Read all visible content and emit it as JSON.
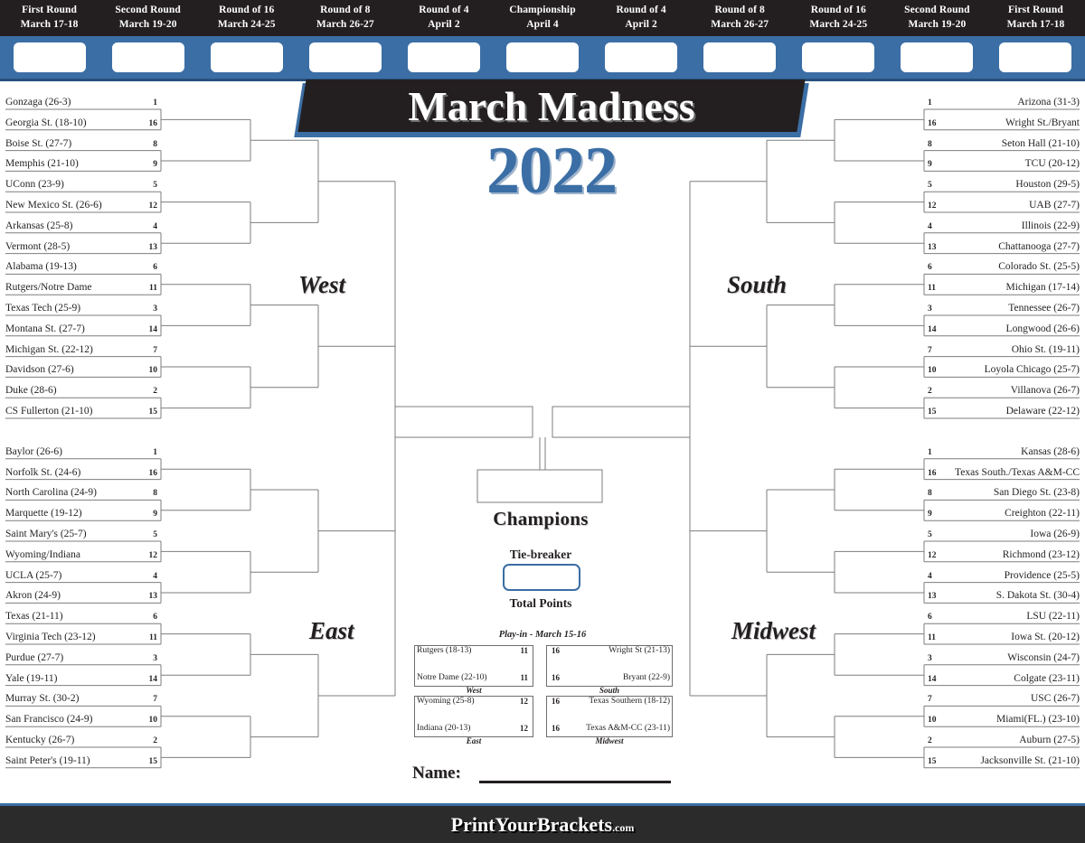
{
  "title": {
    "main": "March Madness",
    "year": "2022"
  },
  "colors": {
    "header_dark": "#231f20",
    "accent_blue": "#3b6ea5",
    "line": "#6e6e6e",
    "footer": "#2b2b2b"
  },
  "rounds": [
    {
      "name": "First Round",
      "dates": "March 17-18"
    },
    {
      "name": "Second Round",
      "dates": "March 19-20"
    },
    {
      "name": "Round of 16",
      "dates": "March 24-25"
    },
    {
      "name": "Round of 8",
      "dates": "March 26-27"
    },
    {
      "name": "Round of 4",
      "dates": "April 2"
    },
    {
      "name": "Championship",
      "dates": "April 4"
    },
    {
      "name": "Round of 4",
      "dates": "April 2"
    },
    {
      "name": "Round of 8",
      "dates": "March 26-27"
    },
    {
      "name": "Round of 16",
      "dates": "March 24-25"
    },
    {
      "name": "Second Round",
      "dates": "March 19-20"
    },
    {
      "name": "First Round",
      "dates": "March 17-18"
    }
  ],
  "regions": {
    "west": "West",
    "east": "East",
    "south": "South",
    "midwest": "Midwest"
  },
  "teams": {
    "west": [
      {
        "seed": "1",
        "name": "Gonzaga (26-3)"
      },
      {
        "seed": "16",
        "name": "Georgia St. (18-10)"
      },
      {
        "seed": "8",
        "name": "Boise St. (27-7)"
      },
      {
        "seed": "9",
        "name": "Memphis (21-10)"
      },
      {
        "seed": "5",
        "name": "UConn (23-9)"
      },
      {
        "seed": "12",
        "name": "New Mexico St. (26-6)"
      },
      {
        "seed": "4",
        "name": "Arkansas (25-8)"
      },
      {
        "seed": "13",
        "name": "Vermont (28-5)"
      },
      {
        "seed": "6",
        "name": "Alabama (19-13)"
      },
      {
        "seed": "11",
        "name": "Rutgers/Notre Dame"
      },
      {
        "seed": "3",
        "name": "Texas Tech (25-9)"
      },
      {
        "seed": "14",
        "name": "Montana St. (27-7)"
      },
      {
        "seed": "7",
        "name": "Michigan St. (22-12)"
      },
      {
        "seed": "10",
        "name": "Davidson (27-6)"
      },
      {
        "seed": "2",
        "name": "Duke (28-6)"
      },
      {
        "seed": "15",
        "name": "CS Fullerton (21-10)"
      }
    ],
    "east": [
      {
        "seed": "1",
        "name": "Baylor (26-6)"
      },
      {
        "seed": "16",
        "name": "Norfolk St. (24-6)"
      },
      {
        "seed": "8",
        "name": "North Carolina (24-9)"
      },
      {
        "seed": "9",
        "name": "Marquette (19-12)"
      },
      {
        "seed": "5",
        "name": "Saint Mary's (25-7)"
      },
      {
        "seed": "12",
        "name": "Wyoming/Indiana"
      },
      {
        "seed": "4",
        "name": "UCLA (25-7)"
      },
      {
        "seed": "13",
        "name": "Akron (24-9)"
      },
      {
        "seed": "6",
        "name": "Texas (21-11)"
      },
      {
        "seed": "11",
        "name": "Virginia Tech (23-12)"
      },
      {
        "seed": "3",
        "name": "Purdue (27-7)"
      },
      {
        "seed": "14",
        "name": "Yale (19-11)"
      },
      {
        "seed": "7",
        "name": "Murray St. (30-2)"
      },
      {
        "seed": "10",
        "name": "San Francisco (24-9)"
      },
      {
        "seed": "2",
        "name": "Kentucky (26-7)"
      },
      {
        "seed": "15",
        "name": "Saint Peter's (19-11)"
      }
    ],
    "south": [
      {
        "seed": "1",
        "name": "Arizona (31-3)"
      },
      {
        "seed": "16",
        "name": "Wright St./Bryant"
      },
      {
        "seed": "8",
        "name": "Seton Hall (21-10)"
      },
      {
        "seed": "9",
        "name": "TCU (20-12)"
      },
      {
        "seed": "5",
        "name": "Houston (29-5)"
      },
      {
        "seed": "12",
        "name": "UAB (27-7)"
      },
      {
        "seed": "4",
        "name": "Illinois (22-9)"
      },
      {
        "seed": "13",
        "name": "Chattanooga (27-7)"
      },
      {
        "seed": "6",
        "name": "Colorado St. (25-5)"
      },
      {
        "seed": "11",
        "name": "Michigan (17-14)"
      },
      {
        "seed": "3",
        "name": "Tennessee (26-7)"
      },
      {
        "seed": "14",
        "name": "Longwood (26-6)"
      },
      {
        "seed": "7",
        "name": "Ohio St. (19-11)"
      },
      {
        "seed": "10",
        "name": "Loyola Chicago (25-7)"
      },
      {
        "seed": "2",
        "name": "Villanova (26-7)"
      },
      {
        "seed": "15",
        "name": "Delaware (22-12)"
      }
    ],
    "midwest": [
      {
        "seed": "1",
        "name": "Kansas (28-6)"
      },
      {
        "seed": "16",
        "name": "Texas South./Texas A&M-CC"
      },
      {
        "seed": "8",
        "name": "San Diego St. (23-8)"
      },
      {
        "seed": "9",
        "name": "Creighton (22-11)"
      },
      {
        "seed": "5",
        "name": "Iowa (26-9)"
      },
      {
        "seed": "12",
        "name": "Richmond (23-12)"
      },
      {
        "seed": "4",
        "name": "Providence (25-5)"
      },
      {
        "seed": "13",
        "name": "S. Dakota St. (30-4)"
      },
      {
        "seed": "6",
        "name": "LSU (22-11)"
      },
      {
        "seed": "11",
        "name": "Iowa St. (20-12)"
      },
      {
        "seed": "3",
        "name": "Wisconsin (24-7)"
      },
      {
        "seed": "14",
        "name": "Colgate (23-11)"
      },
      {
        "seed": "7",
        "name": "USC (26-7)"
      },
      {
        "seed": "10",
        "name": "Miami(FL.) (23-10)"
      },
      {
        "seed": "2",
        "name": "Auburn (27-5)"
      },
      {
        "seed": "15",
        "name": "Jacksonville St. (21-10)"
      }
    ]
  },
  "center": {
    "champions_label": "Champions",
    "tiebreaker_label": "Tie-breaker",
    "total_points_label": "Total Points",
    "name_label": "Name:"
  },
  "playin": {
    "title": "Play-in - March 15-16",
    "groups": [
      {
        "region": "West",
        "side": "left",
        "rows": [
          {
            "seed": "11",
            "name": "Rutgers (18-13)"
          },
          {
            "seed": "11",
            "name": "Notre Dame (22-10)"
          }
        ]
      },
      {
        "region": "South",
        "side": "right",
        "rows": [
          {
            "seed": "16",
            "name": "Wright St (21-13)"
          },
          {
            "seed": "16",
            "name": "Bryant (22-9)"
          }
        ]
      },
      {
        "region": "East",
        "side": "left",
        "rows": [
          {
            "seed": "12",
            "name": "Wyoming (25-8)"
          },
          {
            "seed": "12",
            "name": "Indiana (20-13)"
          }
        ]
      },
      {
        "region": "Midwest",
        "side": "right",
        "rows": [
          {
            "seed": "16",
            "name": "Texas Southern (18-12)"
          },
          {
            "seed": "16",
            "name": "Texas A&M-CC (23-11)"
          }
        ]
      }
    ]
  },
  "footer": {
    "brand": "PrintYourBrackets",
    "domain": ".com"
  }
}
